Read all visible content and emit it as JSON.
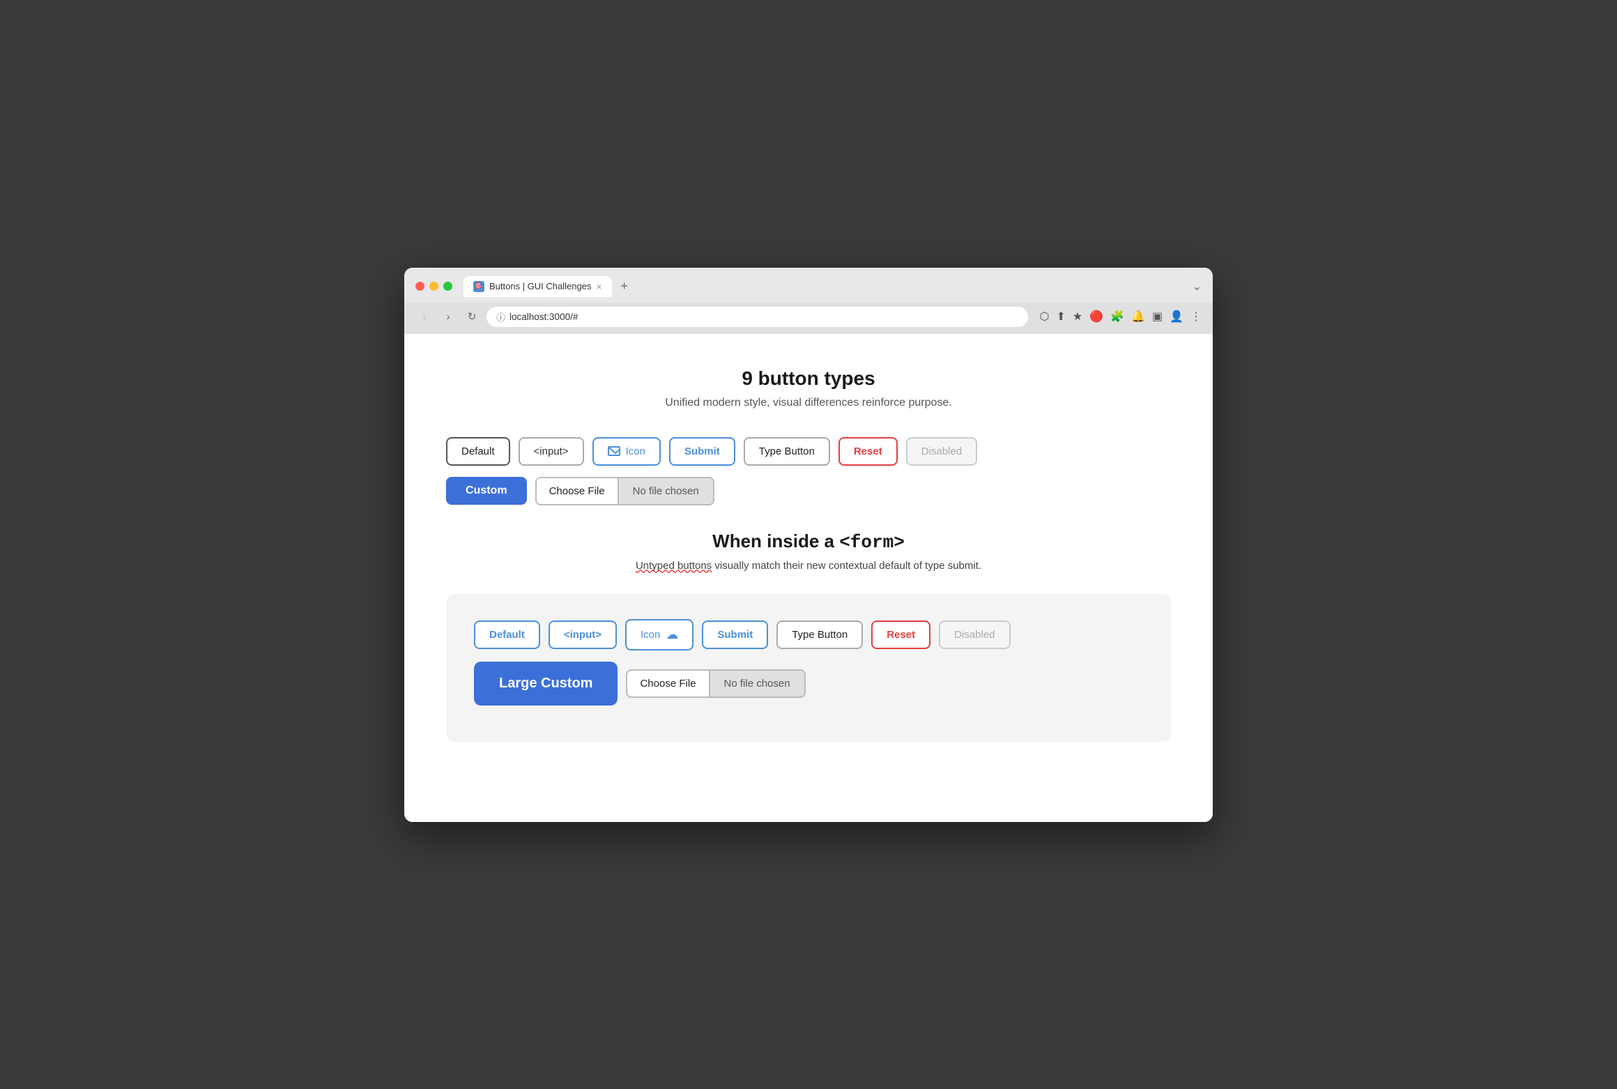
{
  "browser": {
    "traffic_lights": [
      "red",
      "yellow",
      "green"
    ],
    "tab": {
      "favicon_label": "🎯",
      "title": "Buttons | GUI Challenges",
      "close_icon": "×"
    },
    "new_tab_icon": "+",
    "chevron_icon": "⌄",
    "nav": {
      "back_icon": "‹",
      "forward_icon": "›",
      "reload_icon": "↻",
      "url": "localhost:3000/#"
    },
    "toolbar": {
      "icons": [
        "⬡",
        "⬆",
        "★",
        "🔴",
        "🧩",
        "🔔",
        "▣",
        "👤",
        "⋮"
      ]
    }
  },
  "page": {
    "title": "9 button types",
    "subtitle": "Unified modern style, visual differences reinforce purpose.",
    "buttons_row1": [
      {
        "label": "Default",
        "type": "default"
      },
      {
        "label": "<input>",
        "type": "input"
      },
      {
        "label": "Icon",
        "type": "icon"
      },
      {
        "label": "Submit",
        "type": "submit"
      },
      {
        "label": "Type Button",
        "type": "type-button"
      },
      {
        "label": "Reset",
        "type": "reset"
      },
      {
        "label": "Disabled",
        "type": "disabled"
      }
    ],
    "buttons_row2": [
      {
        "label": "Custom",
        "type": "custom"
      }
    ],
    "file_input_1": {
      "choose_label": "Choose File",
      "no_file_label": "No file chosen"
    },
    "form_section": {
      "title": "When inside a ",
      "title_code": "<form>",
      "subtitle_normal": "visually match their new contextual default of type submit.",
      "subtitle_underlined": "Untyped buttons",
      "buttons_row1": [
        {
          "label": "Default",
          "type": "default-form"
        },
        {
          "label": "<input>",
          "type": "input-form"
        },
        {
          "label": "Icon",
          "type": "icon-form"
        },
        {
          "label": "Submit",
          "type": "submit-form"
        },
        {
          "label": "Type Button",
          "type": "type-button-form"
        },
        {
          "label": "Reset",
          "type": "reset-form"
        },
        {
          "label": "Disabled",
          "type": "disabled-form"
        }
      ],
      "large_custom_label": "Large Custom",
      "file_input": {
        "choose_label": "Choose File",
        "no_file_label": "No file chosen"
      }
    }
  }
}
